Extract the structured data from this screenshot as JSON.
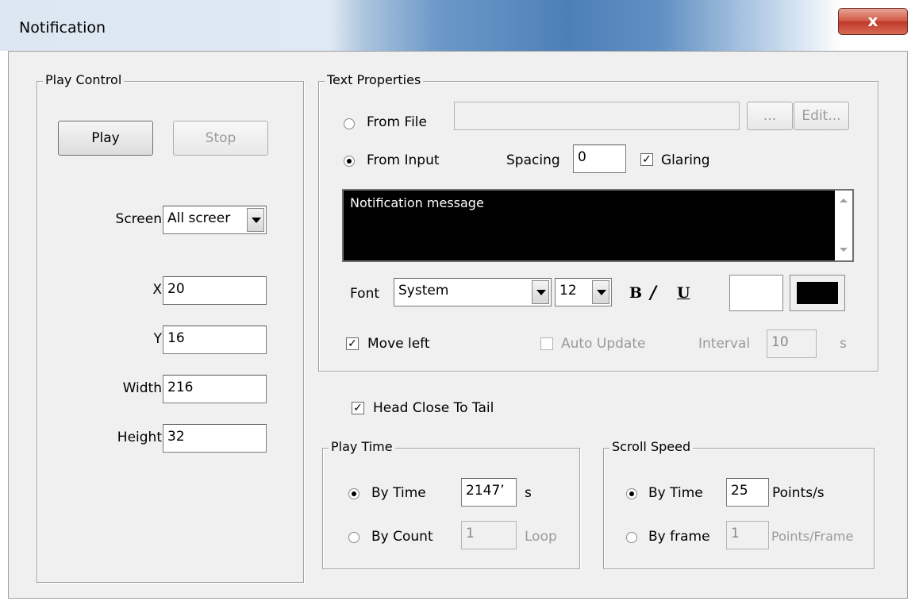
{
  "window": {
    "title": "Notification",
    "close_label": "x"
  },
  "play_control": {
    "legend": "Play Control",
    "play_label": "Play",
    "stop_label": "Stop",
    "screen_label": "Screen",
    "screen_value": "All screer",
    "x_label": "X",
    "x_value": "20",
    "y_label": "Y",
    "y_value": "16",
    "width_label": "Width",
    "width_value": "216",
    "height_label": "Height",
    "height_value": "32"
  },
  "text_properties": {
    "legend": "Text Properties",
    "from_file_label": "From File",
    "from_file_value": "",
    "browse_label": "...",
    "edit_label": "Edit...",
    "from_input_label": "From Input",
    "spacing_label": "Spacing",
    "spacing_value": "0",
    "glaring_label": "Glaring",
    "message_text": "Notification message",
    "font_label": "Font",
    "font_value": "System",
    "size_value": "12",
    "bold_label": "B",
    "italic_label": "I",
    "underline_label": "U",
    "move_left_label": "Move left",
    "auto_update_label": "Auto Update",
    "interval_label": "Interval",
    "interval_value": "10",
    "interval_unit": "s",
    "fore_color": "#ffffff",
    "back_color": "#000000"
  },
  "head_close_label": "Head Close To Tail",
  "play_time": {
    "legend": "Play Time",
    "by_time_label": "By Time",
    "by_time_value": "2147’",
    "by_time_unit": "s",
    "by_count_label": "By Count",
    "by_count_value": "1",
    "by_count_unit": "Loop"
  },
  "scroll_speed": {
    "legend": "Scroll Speed",
    "by_time_label": "By Time",
    "by_time_value": "25",
    "by_time_unit": "Points/s",
    "by_frame_label": "By frame",
    "by_frame_value": "1",
    "by_frame_unit": "Points/Frame"
  }
}
